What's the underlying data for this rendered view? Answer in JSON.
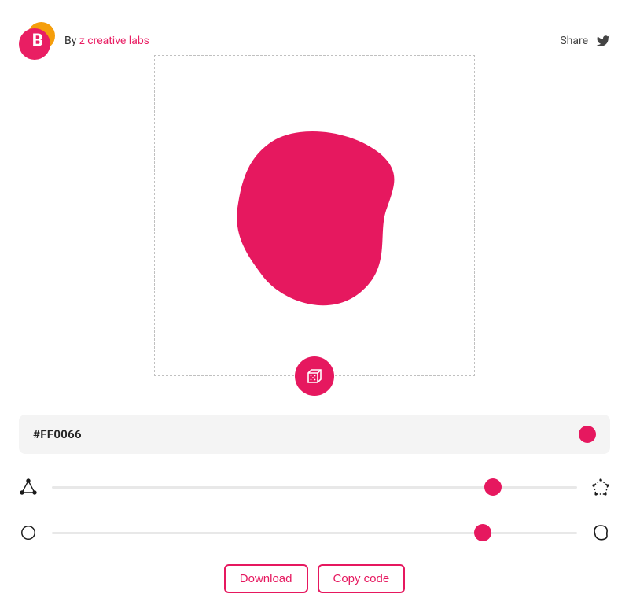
{
  "header": {
    "byline_prefix": "By ",
    "byline_link": "z creative labs",
    "share_label": "Share"
  },
  "colors": {
    "accent": "#e6185f",
    "logo_orange": "#f59e0b",
    "logo_pink": "#e91e63",
    "blob_fill": "#e6185f"
  },
  "color_input": {
    "value": "#FF0066"
  },
  "sliders": {
    "complexity": {
      "min": 0,
      "max": 100,
      "value": 84,
      "label_min_icon": "triangle-points-icon",
      "label_max_icon": "pentagon-points-icon"
    },
    "contrast": {
      "min": 0,
      "max": 100,
      "value": 82,
      "label_min_icon": "circle-icon",
      "label_max_icon": "blob-outline-icon"
    }
  },
  "actions": {
    "download_label": "Download",
    "copy_label": "Copy code"
  },
  "logo_letter": "B"
}
